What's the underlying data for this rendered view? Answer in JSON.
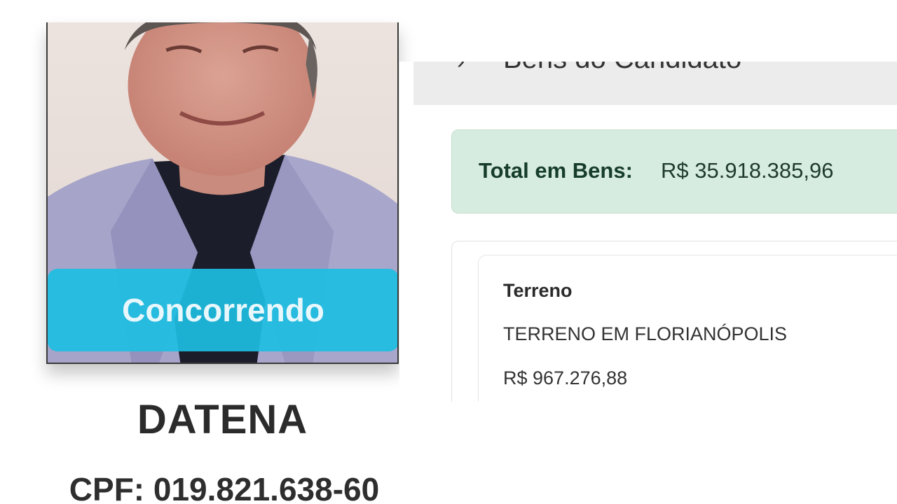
{
  "candidate": {
    "status_label": "Concorrendo",
    "name": "DATENA",
    "cpf": "CPF: 019.821.638-60",
    "photo_icon": "candidate-photo"
  },
  "assets": {
    "section_title": "Bens do Candidato",
    "section_chevron_icon": "chevron-right-icon",
    "total_label": "Total em Bens:",
    "total_value": "R$ 35.918.385,96",
    "items": [
      {
        "type": "Terreno",
        "description": "TERRENO EM FLORIANÓPOLIS",
        "value": "R$ 967.276,88"
      }
    ]
  },
  "colors": {
    "status_banner": "#1cbee2",
    "total_box_bg": "#d7ece0",
    "total_label": "#163d2a",
    "header_bg": "#ececec"
  }
}
